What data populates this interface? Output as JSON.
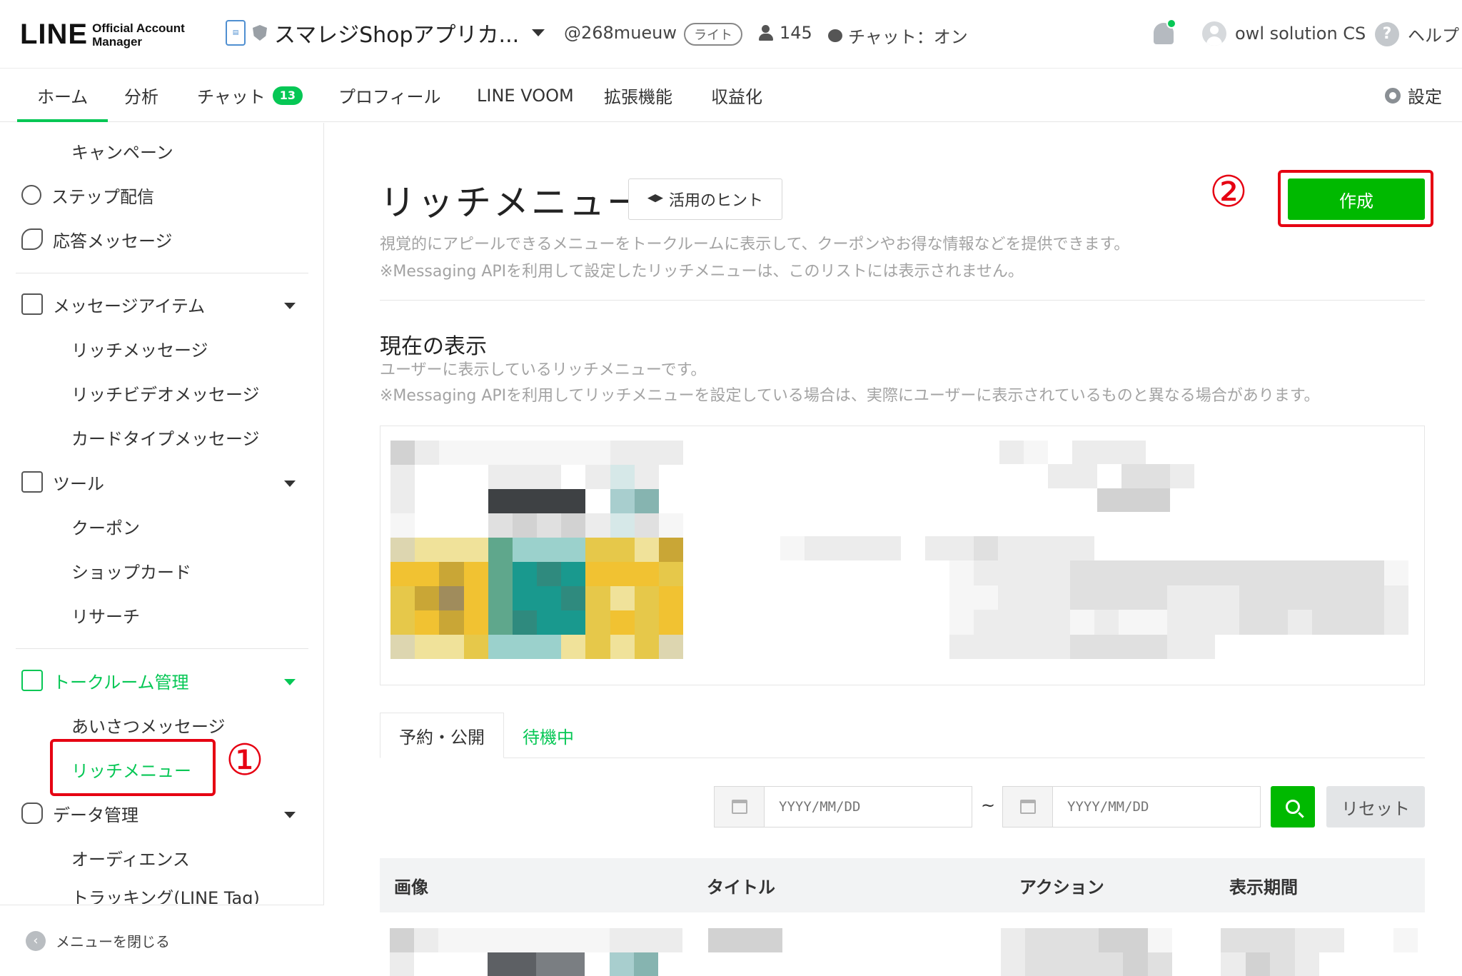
{
  "header": {
    "logo_main": "LINE",
    "logo_sub_line1": "Official Account",
    "logo_sub_line2": "Manager",
    "account_name": "スマレジShopアプリカ...",
    "account_id": "@268mueuw",
    "plan_badge": "ライト",
    "friend_count": "145",
    "chat_status": "チャット：オン",
    "user_name": "owl solution CS",
    "help_label": "ヘルプ"
  },
  "nav": {
    "tabs": [
      {
        "label": "ホーム"
      },
      {
        "label": "分析"
      },
      {
        "label": "チャット"
      },
      {
        "label": "プロフィール"
      },
      {
        "label": "LINE VOOM"
      },
      {
        "label": "拡張機能"
      },
      {
        "label": "収益化"
      }
    ],
    "chat_badge": "13",
    "settings_label": "設定"
  },
  "sidebar": {
    "campaign": "キャンペーン",
    "step": "ステップ配信",
    "auto_reply": "応答メッセージ",
    "message_items": "メッセージアイテム",
    "rich_message": "リッチメッセージ",
    "rich_video": "リッチビデオメッセージ",
    "card_type": "カードタイプメッセージ",
    "tools": "ツール",
    "coupon": "クーポン",
    "shop_card": "ショップカード",
    "research": "リサーチ",
    "talkroom": "トークルーム管理",
    "greeting": "あいさつメッセージ",
    "rich_menu": "リッチメニュー",
    "data_mgmt": "データ管理",
    "audience": "オーディエンス",
    "tracking": "トラッキング(LINE Tag)",
    "close_menu": "メニューを閉じる"
  },
  "annotations": {
    "one": "①",
    "two": "②"
  },
  "main": {
    "title": "リッチメニュー",
    "hint_button": "活用のヒント",
    "create_button": "作成",
    "desc_line1": "視覚的にアピールできるメニューをトークルームに表示して、クーポンやお得な情報などを提供できます。",
    "desc_line2": "※Messaging APIを利用して設定したリッチメニューは、このリストには表示されません。",
    "current_title": "現在の表示",
    "current_desc1": "ユーザーに表示しているリッチメニューです。",
    "current_desc2": "※Messaging APIを利用してリッチメニューを設定している場合は、実際にユーザーに表示されているものと異なる場合があります。",
    "tab_scheduled": "予約・公開",
    "tab_waiting": "待機中",
    "date_placeholder_from": "YYYY/MM/DD",
    "date_placeholder_to": "YYYY/MM/DD",
    "tilde": "~",
    "reset_button": "リセット",
    "columns": [
      "画像",
      "タイトル",
      "アクション",
      "表示期間"
    ]
  },
  "colors": {
    "brand_green": "#06c755",
    "button_green": "#00b900",
    "annotation_red": "#e60012"
  }
}
